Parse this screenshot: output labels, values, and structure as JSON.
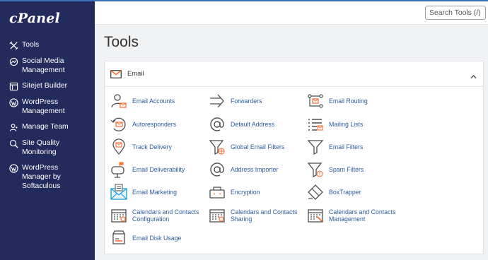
{
  "brand": {
    "logo_text": "cPanel"
  },
  "sidebar": {
    "items": [
      {
        "label": "Tools",
        "icon": "tools-icon"
      },
      {
        "label": "Social Media Management",
        "icon": "social-media-icon"
      },
      {
        "label": "Sitejet Builder",
        "icon": "sitejet-icon"
      },
      {
        "label": "WordPress Management",
        "icon": "wordpress-icon"
      },
      {
        "label": "Manage Team",
        "icon": "team-icon"
      },
      {
        "label": "Site Quality Monitoring",
        "icon": "site-quality-icon"
      },
      {
        "label": "WordPress Manager by Softaculous",
        "icon": "wordpress-icon"
      }
    ]
  },
  "header": {
    "search_placeholder": "Search Tools (/)"
  },
  "main": {
    "title": "Tools",
    "section": {
      "title": "Email",
      "icon": "mail-envelope-icon",
      "tools": [
        {
          "label": "Email Accounts",
          "icon": "email-accounts-icon"
        },
        {
          "label": "Forwarders",
          "icon": "forwarders-icon"
        },
        {
          "label": "Email Routing",
          "icon": "email-routing-icon"
        },
        {
          "label": "Autoresponders",
          "icon": "autoresponders-icon"
        },
        {
          "label": "Default Address",
          "icon": "default-address-icon"
        },
        {
          "label": "Mailing Lists",
          "icon": "mailing-lists-icon"
        },
        {
          "label": "Track Delivery",
          "icon": "track-delivery-icon"
        },
        {
          "label": "Global Email Filters",
          "icon": "global-email-filters-icon"
        },
        {
          "label": "Email Filters",
          "icon": "email-filters-icon"
        },
        {
          "label": "Email Deliverability",
          "icon": "email-deliverability-icon"
        },
        {
          "label": "Address Importer",
          "icon": "address-importer-icon"
        },
        {
          "label": "Spam Filters",
          "icon": "spam-filters-icon"
        },
        {
          "label": "Email Marketing",
          "icon": "email-marketing-icon"
        },
        {
          "label": "Encryption",
          "icon": "encryption-icon"
        },
        {
          "label": "BoxTrapper",
          "icon": "boxtrapper-icon"
        },
        {
          "label": "Calendars and Contacts Configuration",
          "icon": "calendar-config-icon"
        },
        {
          "label": "Calendars and Contacts Sharing",
          "icon": "calendar-sharing-icon"
        },
        {
          "label": "Calendars and Contacts Management",
          "icon": "calendar-management-icon"
        },
        {
          "label": "Email Disk Usage",
          "icon": "email-disk-usage-icon"
        }
      ]
    }
  },
  "colors": {
    "sidebar_bg": "#232a5c",
    "accent_orange": "#ff6c2c",
    "link_blue": "#2a5d9f",
    "icon_gray": "#4d4d4d"
  }
}
